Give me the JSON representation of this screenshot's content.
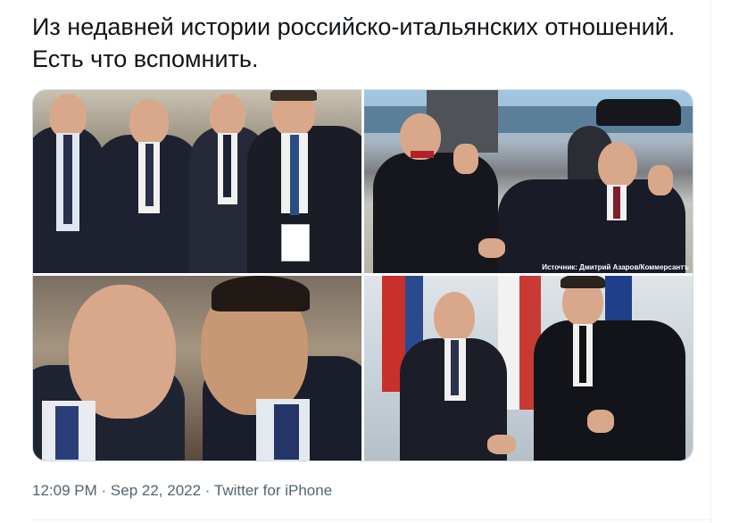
{
  "tweet": {
    "text": "Из недавней истории российско-итальянских отношений. Есть что вспомнить.",
    "photos": [
      {
        "name": "photo-1"
      },
      {
        "name": "photo-2",
        "caption": "Источник: Дмитрий Азаров/Коммерсантъ"
      },
      {
        "name": "photo-3"
      },
      {
        "name": "photo-4"
      }
    ],
    "time": "12:09 PM",
    "separator1": "·",
    "date": "Sep 22, 2022",
    "separator2": "·",
    "source": "Twitter for iPhone"
  }
}
